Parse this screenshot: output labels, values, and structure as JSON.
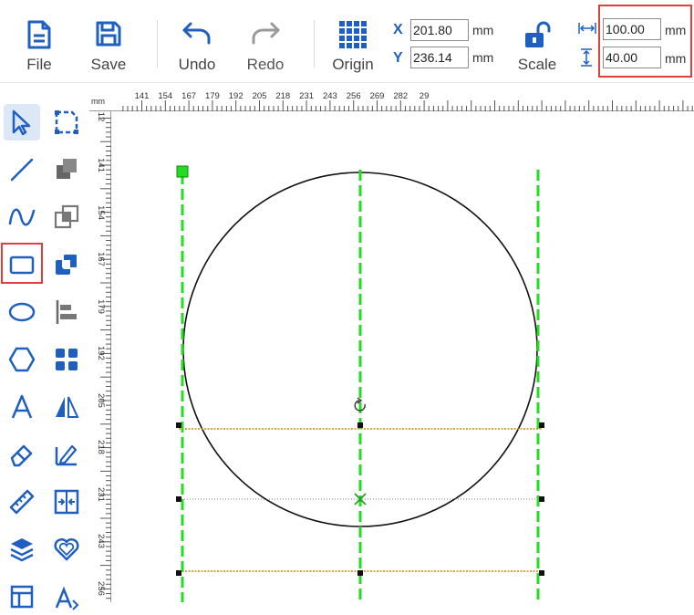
{
  "toolbar": {
    "file_label": "File",
    "save_label": "Save",
    "undo_label": "Undo",
    "redo_label": "Redo",
    "origin_label": "Origin",
    "scale_label": "Scale",
    "x_label": "X",
    "y_label": "Y",
    "x_value": "201.80",
    "y_value": "236.14",
    "width_value": "100.00",
    "height_value": "40.00",
    "unit": "mm"
  },
  "rulers": {
    "unit": "mm",
    "top_ticks": [
      "141",
      "154",
      "167",
      "179",
      "192",
      "205",
      "218",
      "231",
      "243",
      "256",
      "269",
      "282",
      "29"
    ],
    "left_ticks": [
      "12",
      "141",
      "154",
      "167",
      "179",
      "192",
      "205",
      "218",
      "231",
      "243",
      "256"
    ]
  },
  "colors": {
    "accent": "#1f5fbf",
    "highlight": "#e0403a",
    "guide": "#22dd22",
    "handle": "#111111",
    "selection_line": "#c98a00"
  },
  "tools": [
    {
      "name": "select-tool",
      "icon": "pointer-icon",
      "active": true
    },
    {
      "name": "node-edit-tool",
      "icon": "node-edit-icon"
    },
    {
      "name": "line-tool",
      "icon": "line-icon"
    },
    {
      "name": "combine-tool",
      "icon": "combine-icon"
    },
    {
      "name": "curve-tool",
      "icon": "curve-icon"
    },
    {
      "name": "group-tool",
      "icon": "group-icon"
    },
    {
      "name": "rectangle-tool",
      "icon": "rectangle-icon"
    },
    {
      "name": "intersect-tool",
      "icon": "intersect-icon"
    },
    {
      "name": "ellipse-tool",
      "icon": "ellipse-icon"
    },
    {
      "name": "align-tool",
      "icon": "align-left-icon"
    },
    {
      "name": "polygon-tool",
      "icon": "hexagon-icon"
    },
    {
      "name": "grid-tool",
      "icon": "grid-icon"
    },
    {
      "name": "text-tool",
      "icon": "text-icon"
    },
    {
      "name": "mirror-tool",
      "icon": "mirror-icon"
    },
    {
      "name": "eraser-tool",
      "icon": "eraser-icon"
    },
    {
      "name": "edit-tool",
      "icon": "pen-ruler-icon"
    },
    {
      "name": "measure-tool",
      "icon": "ruler-icon"
    },
    {
      "name": "distribute-tool",
      "icon": "distribute-icon"
    },
    {
      "name": "layers-tool",
      "icon": "layers-icon"
    },
    {
      "name": "offset-tool",
      "icon": "heart-outline-icon"
    },
    {
      "name": "template-tool",
      "icon": "template-icon"
    },
    {
      "name": "text-path-tool",
      "icon": "text-path-icon"
    }
  ]
}
